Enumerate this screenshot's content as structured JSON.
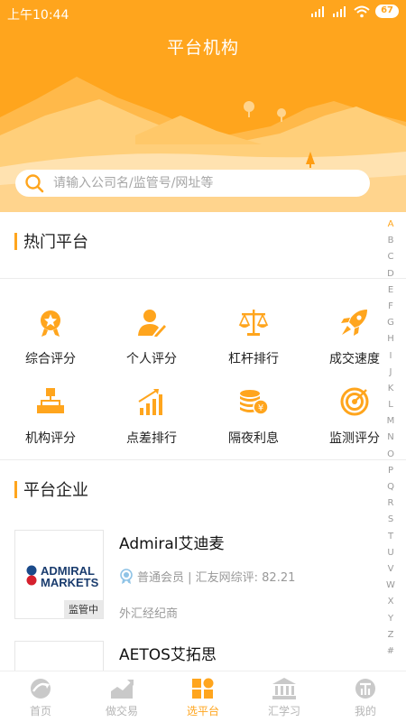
{
  "status_bar": {
    "time": "上午10:44",
    "battery": "67"
  },
  "header": {
    "title": "平台机构"
  },
  "search": {
    "placeholder": "请输入公司名/监管号/网址等"
  },
  "hot_platforms": {
    "title": "热门平台",
    "items": [
      {
        "label": "综合评分",
        "icon": "award-icon"
      },
      {
        "label": "个人评分",
        "icon": "person-edit-icon"
      },
      {
        "label": "杠杆排行",
        "icon": "scale-icon"
      },
      {
        "label": "成交速度",
        "icon": "rocket-icon"
      },
      {
        "label": "机构评分",
        "icon": "org-chart-icon"
      },
      {
        "label": "点差排行",
        "icon": "bar-trend-icon"
      },
      {
        "label": "隔夜利息",
        "icon": "coins-icon"
      },
      {
        "label": "监测评分",
        "icon": "target-icon"
      }
    ]
  },
  "companies_section": {
    "title": "平台企业",
    "items": [
      {
        "name": "Admiral艾迪麦",
        "logo_text_top": "ADMIRAL",
        "logo_text_bottom": "MARKETS",
        "badge": "监管中",
        "meta": "普通会员 | 汇友网综评: 82.21",
        "type": "外汇经纪商"
      },
      {
        "name": "AETOS艾拓思"
      }
    ]
  },
  "alphabet_index": [
    "A",
    "B",
    "C",
    "D",
    "E",
    "F",
    "G",
    "H",
    "I",
    "J",
    "K",
    "L",
    "M",
    "N",
    "O",
    "P",
    "Q",
    "R",
    "S",
    "T",
    "U",
    "V",
    "W",
    "X",
    "Y",
    "Z",
    "#"
  ],
  "tabbar": {
    "tabs": [
      {
        "label": "首页",
        "icon": "home-icon"
      },
      {
        "label": "做交易",
        "icon": "trade-chart-icon"
      },
      {
        "label": "选平台",
        "icon": "platform-grid-icon",
        "active": true
      },
      {
        "label": "汇学习",
        "icon": "bank-icon"
      },
      {
        "label": "我的",
        "icon": "profile-icon"
      }
    ]
  },
  "colors": {
    "accent": "#ffa51d",
    "header_bg": "#ffa51d"
  }
}
